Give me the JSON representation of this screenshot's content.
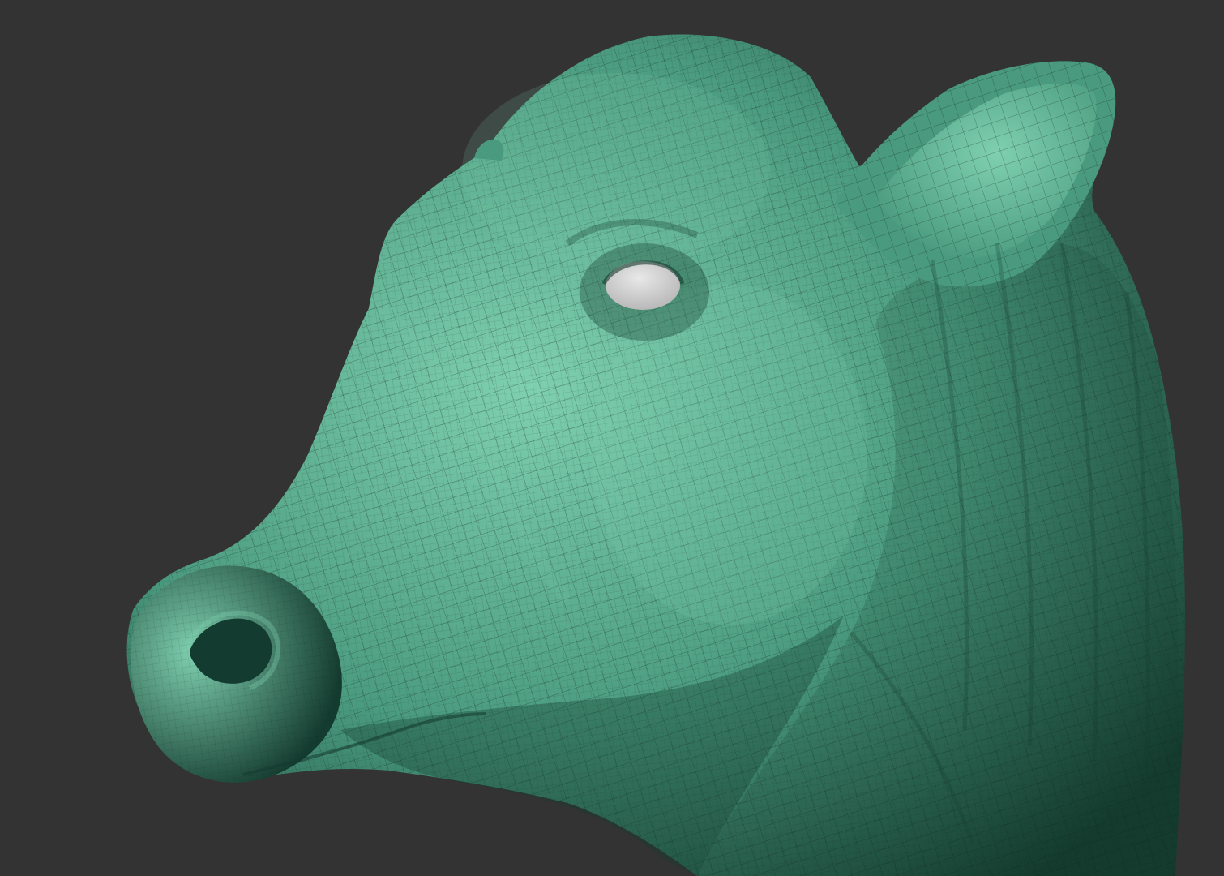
{
  "viewport": {
    "background_color": "#333333"
  },
  "model": {
    "subject": "cow-head",
    "material_color": "#4a9a7f",
    "material_highlight": "#7fd0b0",
    "material_shadow": "#143b2f",
    "wireframe_color": "#0a1f18",
    "eye_color": "#b5b5b5",
    "wireframe_visible": true
  }
}
